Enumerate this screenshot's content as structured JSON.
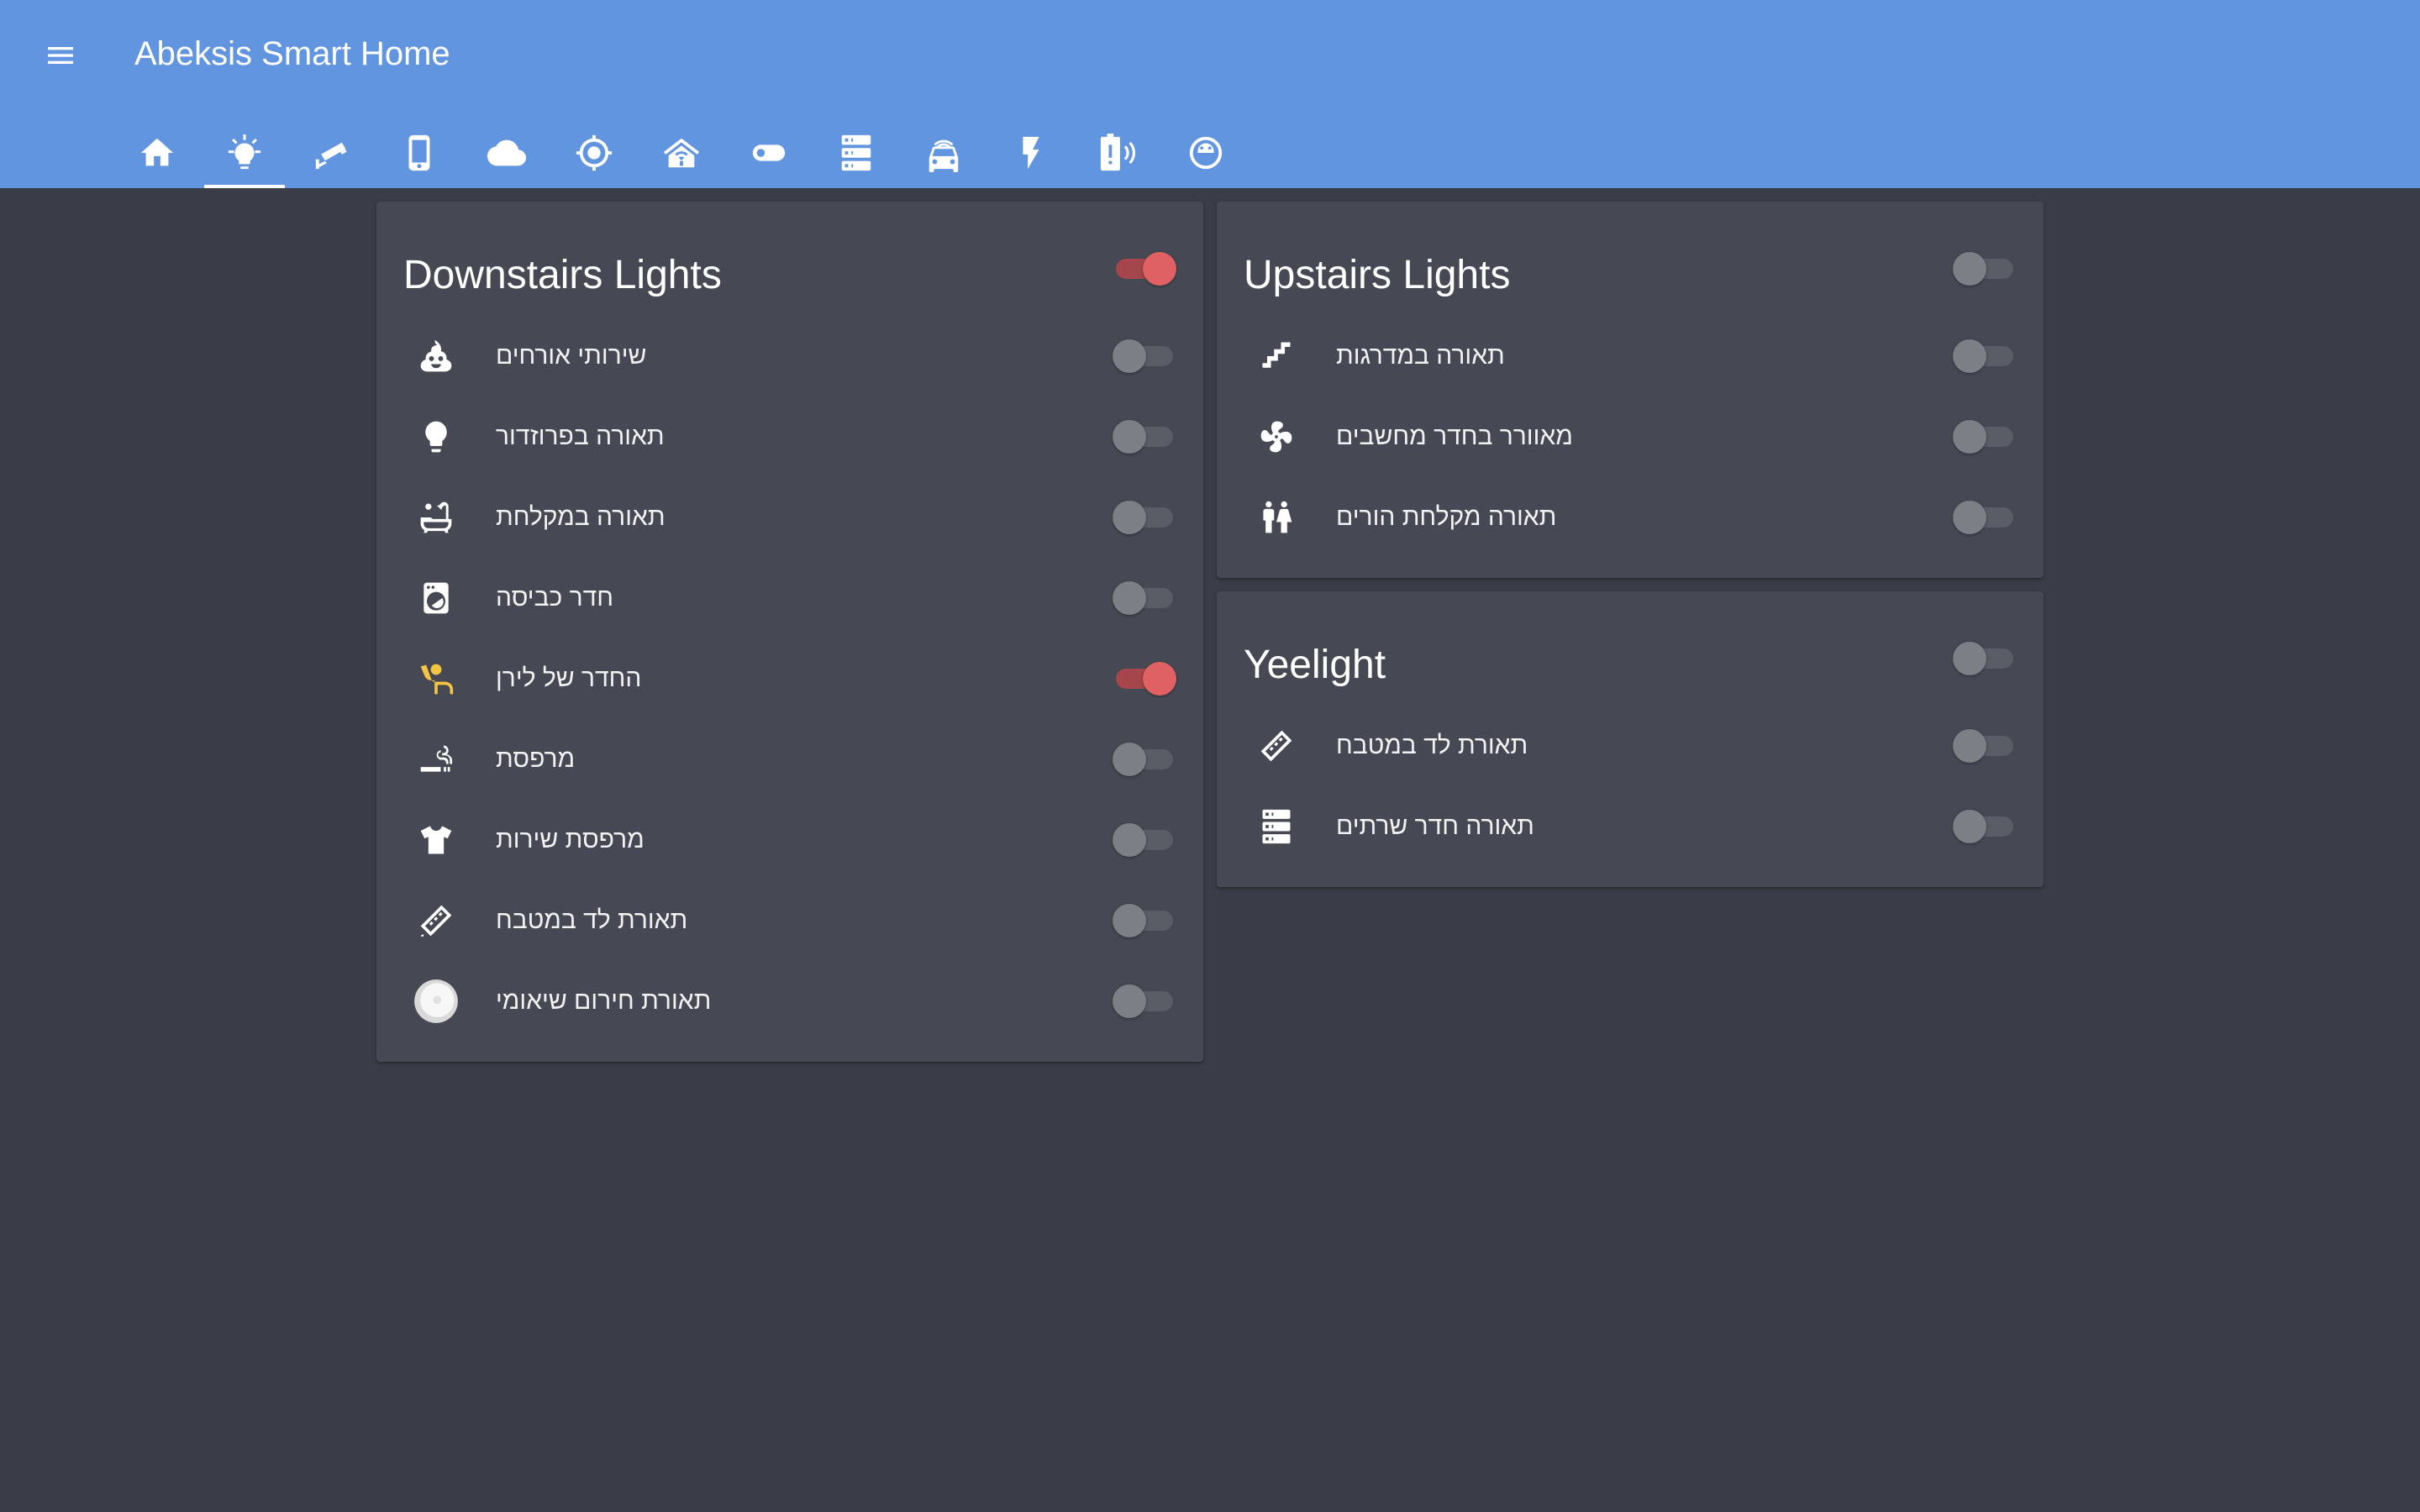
{
  "app": {
    "title": "Abeksis Smart Home",
    "accent_color": "#6195e0",
    "toggle_on_color": "#e06163"
  },
  "tabs": [
    {
      "icon": "home-icon"
    },
    {
      "icon": "lightbulb-icon",
      "active": true
    },
    {
      "icon": "cctv-camera-icon"
    },
    {
      "icon": "phone-icon"
    },
    {
      "icon": "cloud-icon"
    },
    {
      "icon": "crosshairs-gps-icon"
    },
    {
      "icon": "home-wifi-icon"
    },
    {
      "icon": "toggle-icon"
    },
    {
      "icon": "server-icon"
    },
    {
      "icon": "car-connected-icon"
    },
    {
      "icon": "flash-icon"
    },
    {
      "icon": "battery-alert-icon"
    },
    {
      "icon": "robot-vacuum-icon"
    }
  ],
  "downstairs": {
    "title": "Downstairs Lights",
    "on": true,
    "rows": [
      {
        "label": "שירותי אורחים",
        "icon": "emoticon-poop-icon",
        "on": false
      },
      {
        "label": "תאורה בפרוזדור",
        "icon": "lightbulb-icon",
        "on": false
      },
      {
        "label": "תאורה במקלחת",
        "icon": "bathtub-icon",
        "on": false
      },
      {
        "label": "חדר כביסה",
        "icon": "washing-machine-icon",
        "on": false
      },
      {
        "label": "החדר של לירן",
        "icon": "human-greeting-icon",
        "icon_color": "#f4c542",
        "on": true
      },
      {
        "label": "מרפסת",
        "icon": "smoking-icon",
        "on": false
      },
      {
        "label": "מרפסת שירות",
        "icon": "tshirt-icon",
        "on": false
      },
      {
        "label": "תאורת לד במטבח",
        "icon": "led-strip-icon",
        "on": false
      },
      {
        "label": "תאורת חירום שיאומי",
        "icon": "xiaomi-light-image",
        "on": false
      }
    ]
  },
  "upstairs": {
    "title": "Upstairs Lights",
    "on": false,
    "rows": [
      {
        "label": "תאורה במדרגות",
        "icon": "stairs-icon",
        "on": false
      },
      {
        "label": "מאוורר בחדר מחשבים",
        "icon": "fan-icon",
        "on": false
      },
      {
        "label": "תאורה מקלחת הורים",
        "icon": "human-male-female-icon",
        "on": false
      }
    ]
  },
  "yeelight": {
    "title": "Yeelight",
    "on": false,
    "rows": [
      {
        "label": "תאורת לד במטבח",
        "icon": "led-strip-icon",
        "on": false
      },
      {
        "label": "תאורה חדר שרתים",
        "icon": "server-icon",
        "on": false
      }
    ]
  }
}
